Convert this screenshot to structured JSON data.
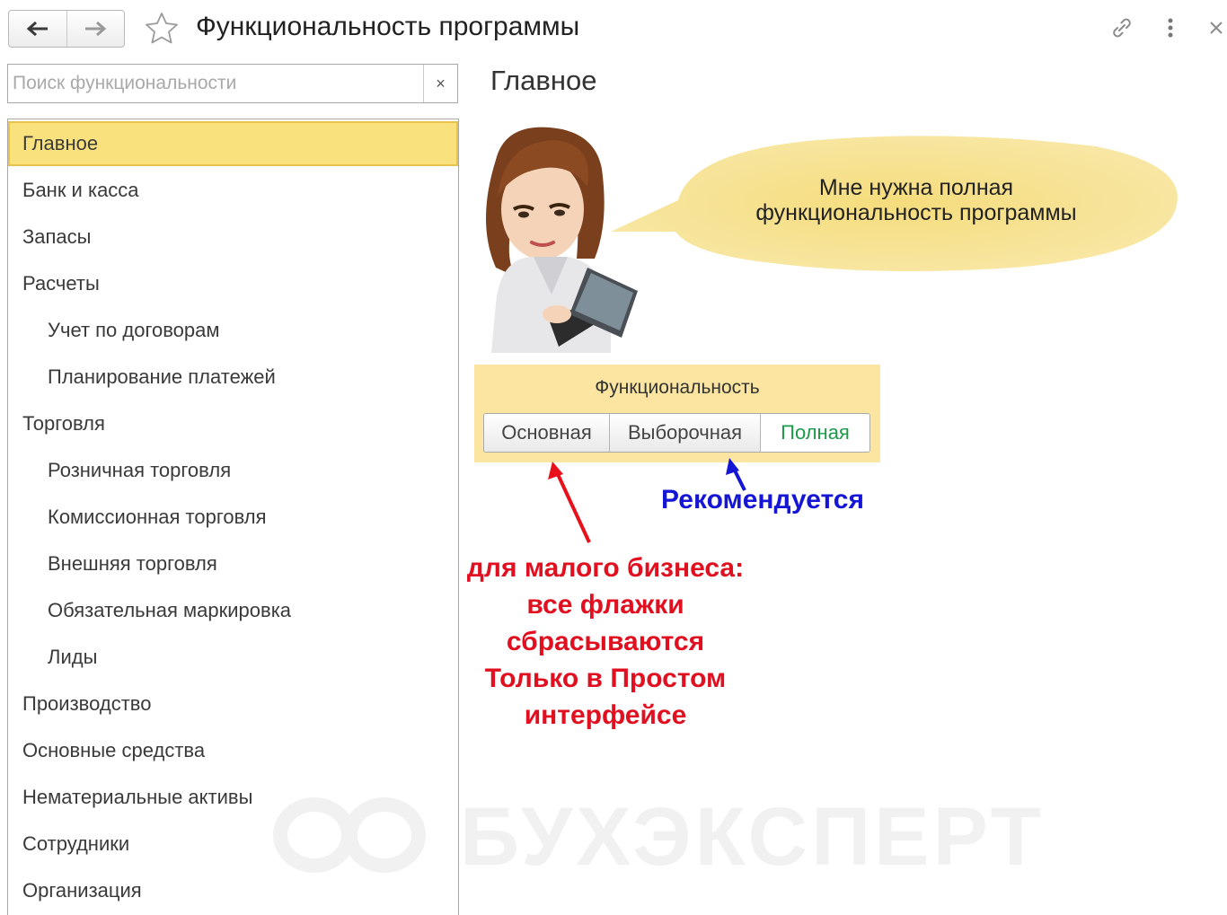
{
  "header": {
    "title": "Функциональность программы"
  },
  "search": {
    "placeholder": "Поиск функциональности",
    "clear_label": "×"
  },
  "sidebar": {
    "items": [
      {
        "label": "Главное",
        "selected": true,
        "level": 0
      },
      {
        "label": "Банк и касса",
        "level": 0
      },
      {
        "label": "Запасы",
        "level": 0
      },
      {
        "label": "Расчеты",
        "level": 0
      },
      {
        "label": "Учет по договорам",
        "level": 1
      },
      {
        "label": "Планирование платежей",
        "level": 1
      },
      {
        "label": "Торговля",
        "level": 0
      },
      {
        "label": "Розничная торговля",
        "level": 1
      },
      {
        "label": "Комиссионная торговля",
        "level": 1
      },
      {
        "label": "Внешняя торговля",
        "level": 1
      },
      {
        "label": "Обязательная маркировка",
        "level": 1
      },
      {
        "label": "Лиды",
        "level": 1
      },
      {
        "label": "Производство",
        "level": 0
      },
      {
        "label": "Основные средства",
        "level": 0
      },
      {
        "label": "Нематериальные активы",
        "level": 0
      },
      {
        "label": "Сотрудники",
        "level": 0
      },
      {
        "label": "Организация",
        "level": 0
      }
    ]
  },
  "main": {
    "section_title": "Главное",
    "bubble_lines": [
      "Мне нужна полная",
      "функциональность программы"
    ],
    "functionality": {
      "label": "Функциональность",
      "options": [
        "Основная",
        "Выборочная",
        "Полная"
      ],
      "selected": "Полная"
    },
    "annotations": {
      "recommended": "Рекомендуется",
      "small_business_lines": [
        "для малого бизнеса:",
        "все флажки",
        "сбрасываются",
        "Только в Простом",
        "интерфейсе"
      ]
    }
  },
  "watermark": "БУХЭКСПЕРТ",
  "colors": {
    "selected_bg": "#f9e27e",
    "panel_bg": "#fbe5a0",
    "bubble_bg": "#f6df86",
    "active_option": "#1b9a48",
    "note_blue": "#1515d6",
    "note_red": "#e01020"
  },
  "icons": [
    "back-arrow-icon",
    "forward-arrow-icon",
    "star-icon",
    "link-icon",
    "more-vertical-icon",
    "close-icon"
  ]
}
